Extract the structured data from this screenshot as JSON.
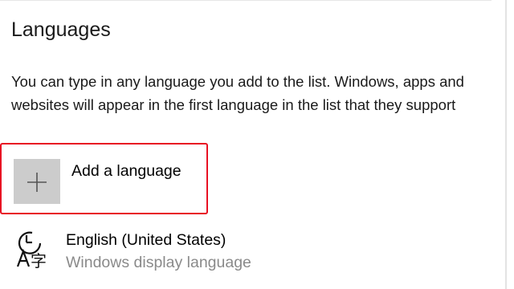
{
  "section": {
    "title": "Languages",
    "description": "You can type in any language you add to the list. Windows, apps and websites will appear in the first language in the list that they support"
  },
  "add_language": {
    "label": "Add a language",
    "icon": "plus-icon",
    "highlight_color": "#e81123"
  },
  "languages": [
    {
      "name": "English (United States)",
      "subtitle": "Windows display language",
      "icon": "language-display-icon"
    }
  ]
}
